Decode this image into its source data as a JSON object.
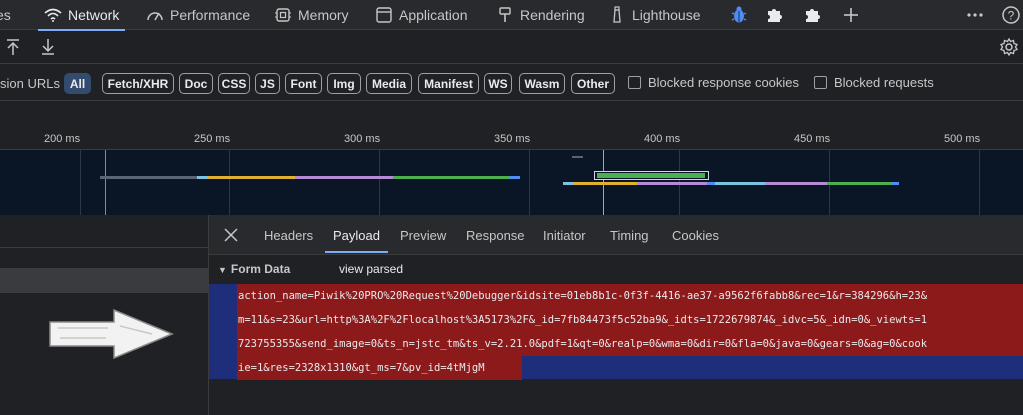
{
  "tabbar": {
    "partial_left": "es",
    "tabs": [
      {
        "label": "Network",
        "icon": "wifi-icon",
        "active": true
      },
      {
        "label": "Performance",
        "icon": "gauge-icon",
        "active": false
      },
      {
        "label": "Memory",
        "icon": "memory-chip-icon",
        "active": false
      },
      {
        "label": "Application",
        "icon": "window-icon",
        "active": false
      },
      {
        "label": "Rendering",
        "icon": "paint-roller-icon",
        "active": false
      },
      {
        "label": "Lighthouse",
        "icon": "lighthouse-icon",
        "active": false
      }
    ],
    "extra_icons": [
      "bug-icon",
      "puzzle-icon",
      "puzzle-icon",
      "plus-icon"
    ],
    "right_icons": [
      "more-vertical-icon",
      "help-icon"
    ]
  },
  "toolbar": {
    "icons": [
      "upload-icon",
      "download-icon",
      "gear-icon"
    ]
  },
  "filters": {
    "lead_text": "sion URLs",
    "chips": [
      {
        "label": "All",
        "active": true
      },
      {
        "label": "Fetch/XHR",
        "active": false
      },
      {
        "label": "Doc",
        "active": false
      },
      {
        "label": "CSS",
        "active": false
      },
      {
        "label": "JS",
        "active": false
      },
      {
        "label": "Font",
        "active": false
      },
      {
        "label": "Img",
        "active": false
      },
      {
        "label": "Media",
        "active": false
      },
      {
        "label": "Manifest",
        "active": false
      },
      {
        "label": "WS",
        "active": false
      },
      {
        "label": "Wasm",
        "active": false
      },
      {
        "label": "Other",
        "active": false
      }
    ],
    "checkboxes": [
      {
        "label": "Blocked response cookies",
        "checked": false
      },
      {
        "label": "Blocked requests",
        "checked": false
      }
    ]
  },
  "timeline": {
    "ticks": [
      "200 ms",
      "250 ms",
      "300 ms",
      "350 ms",
      "400 ms",
      "450 ms",
      "500 ms"
    ]
  },
  "detail": {
    "close_icon": "close-icon",
    "tabs": [
      {
        "label": "Headers",
        "active": false
      },
      {
        "label": "Payload",
        "active": true
      },
      {
        "label": "Preview",
        "active": false
      },
      {
        "label": "Response",
        "active": false
      },
      {
        "label": "Initiator",
        "active": false
      },
      {
        "label": "Timing",
        "active": false
      },
      {
        "label": "Cookies",
        "active": false
      }
    ],
    "section_title": "Form Data",
    "view_parsed": "view parsed",
    "payload_lines": [
      "action_name=Piwik%20PRO%20Request%20Debugger&idsite=01eb8b1c-0f3f-4416-ae37-a9562f6fabb8&rec=1&r=384296&h=23&",
      "m=11&s=23&url=http%3A%2F%2Flocalhost%3A5173%2F&_id=7fb84473f5c52ba9&_idts=1722679874&_idvc=5&_idn=0&_viewts=1",
      "723755355&send_image=0&ts_n=jstc_tm&ts_v=2.21.0&pdf=1&qt=0&realp=0&wma=0&dir=0&fla=0&java=0&gears=0&ag=0&cook",
      "ie=1&res=2328x1310&gt_ms=7&pv_id=4tMjgM"
    ]
  },
  "annotation": {
    "arrow_icon": "arrow-right-icon"
  }
}
